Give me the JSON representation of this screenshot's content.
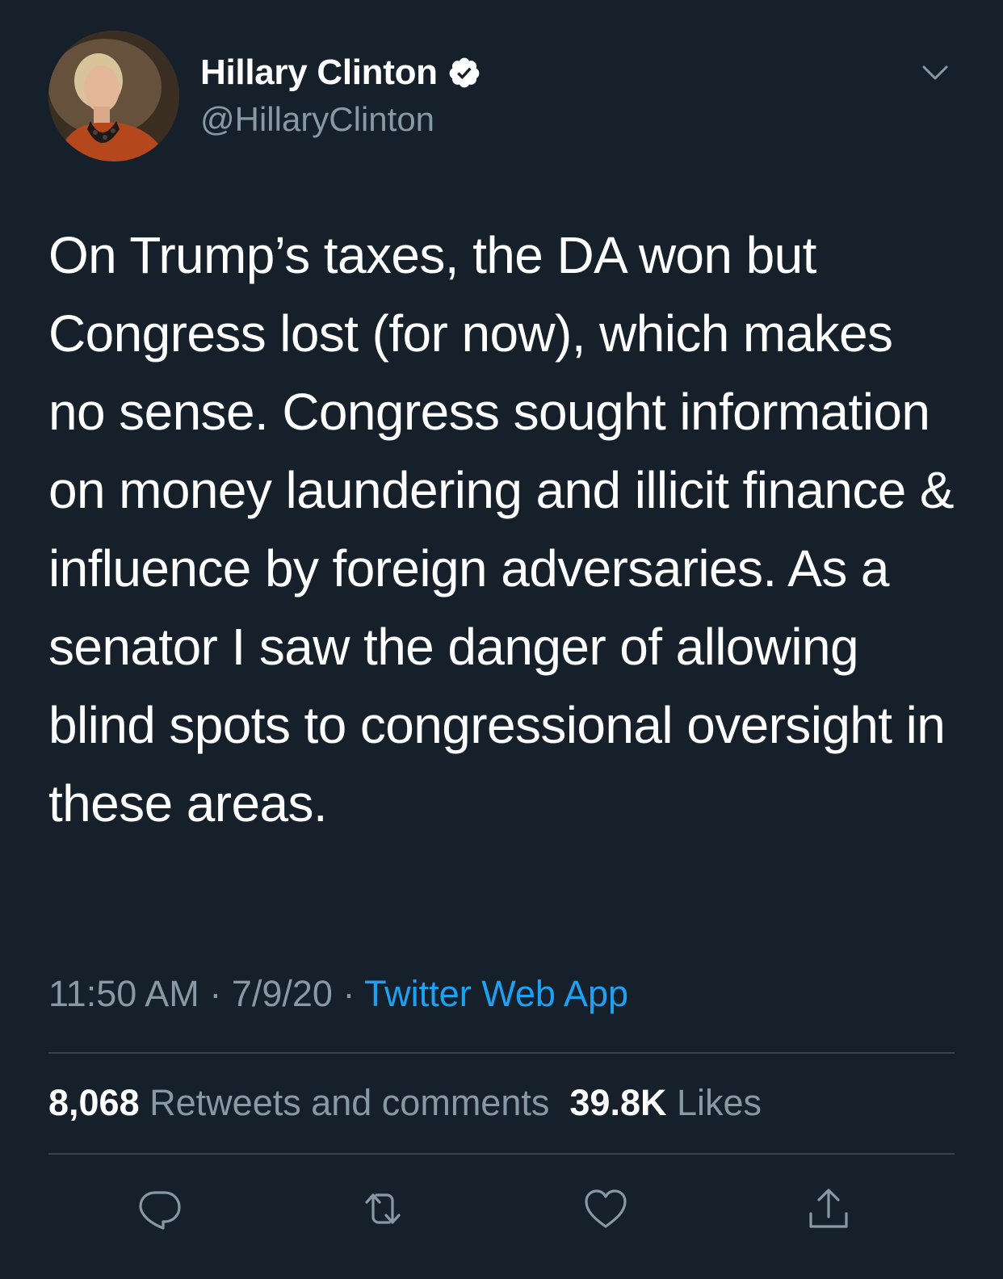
{
  "author": {
    "display_name": "Hillary Clinton",
    "handle": "@HillaryClinton",
    "verified": true
  },
  "tweet": {
    "text": "On Trump’s taxes, the DA won but Congress lost (for now), which makes no sense. Congress sought information on money laundering and illicit finance & influence by foreign adversaries. As a senator I saw the danger of allowing blind spots to congressional oversight in these areas.",
    "time": "11:50 AM",
    "separator": "·",
    "date": "7/9/20",
    "source": "Twitter Web App"
  },
  "stats": {
    "retweets_count": "8,068",
    "retweets_label": "Retweets and comments",
    "likes_count": "39.8K",
    "likes_label": "Likes"
  },
  "icons": {
    "more": "chevron-down-icon",
    "verified": "verified-badge-icon",
    "reply": "reply-icon",
    "retweet": "retweet-icon",
    "like": "heart-icon",
    "share": "share-icon"
  },
  "colors": {
    "background": "#15202b",
    "text": "#ffffff",
    "secondary_text": "#8899a6",
    "accent": "#1da1f2",
    "divider": "#38444d"
  }
}
